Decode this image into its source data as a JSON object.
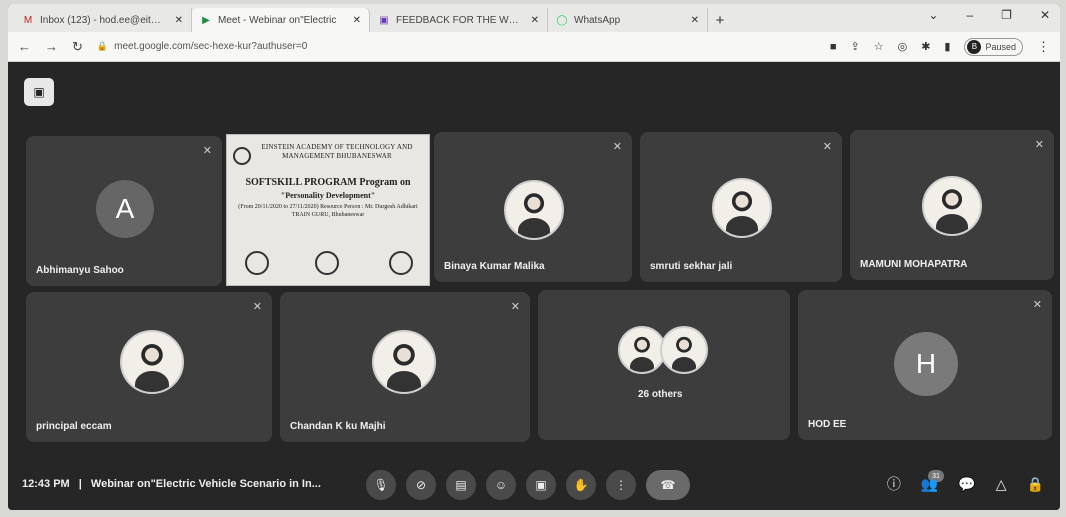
{
  "browser": {
    "tabs": [
      {
        "label": "Inbox (123) - hod.ee@eitm.in -",
        "icon": "gmail-icon"
      },
      {
        "label": "Meet - Webinar on\"Electric",
        "icon": "meet-icon"
      },
      {
        "label": "FEEDBACK FOR THE WEBINAR -",
        "icon": "forms-icon"
      },
      {
        "label": "WhatsApp",
        "icon": "whatsapp-icon"
      }
    ],
    "url": "meet.google.com/sec-hexe-kur?authuser=0",
    "profile_label": "Paused",
    "profile_initial": "B"
  },
  "participants": [
    {
      "name": "Abhimanyu Sahoo",
      "initial": "A",
      "avatar_color": "#e8e8e8"
    },
    {
      "name": "Binaya Kumar Malika"
    },
    {
      "name": "smruti sekhar jali"
    },
    {
      "name": "MAMUNI MOHAPATRA"
    },
    {
      "name": "principal eccam"
    },
    {
      "name": "Chandan K ku Majhi"
    },
    {
      "name": "26 others"
    },
    {
      "name": "HOD EE",
      "initial": "H"
    }
  ],
  "presentation": {
    "institute": "EINSTEIN ACADEMY OF TECHNOLOGY AND MANAGEMENT BHUBANESWAR",
    "program": "SOFTSKILL PROGRAM Program on",
    "topic": "\"Personality Development\"",
    "details": "(From 20/11/2020 to 27/11/2020) Resource Person : Mr. Durgesh Adhikari TRAIN GURU, Bhubaneswar"
  },
  "meeting": {
    "time": "12:43 PM",
    "separator": "|",
    "title": "Webinar on\"Electric Vehicle Scenario in In..."
  },
  "people_count": "31"
}
